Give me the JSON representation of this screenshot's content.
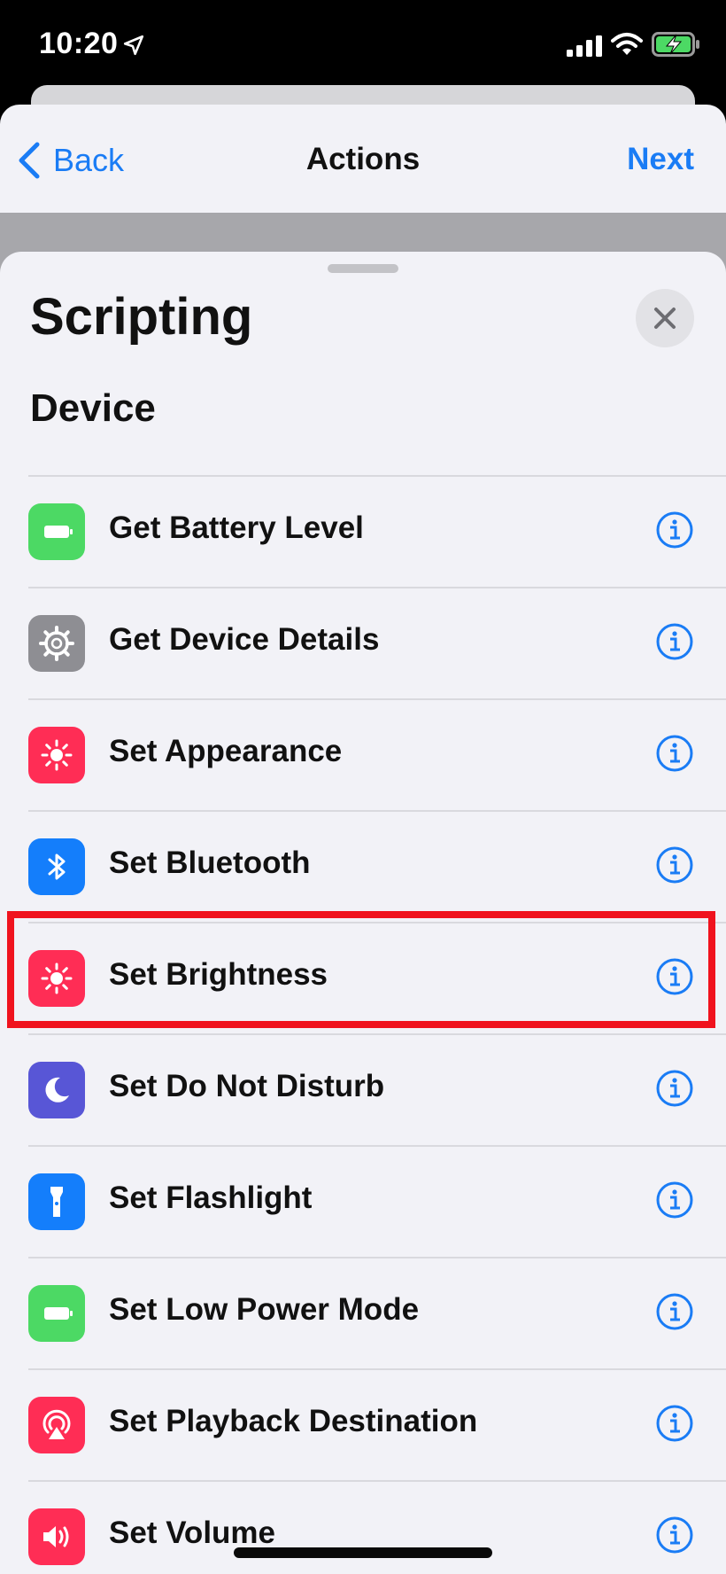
{
  "status_bar": {
    "time": "10:20"
  },
  "nav": {
    "back_label": "Back",
    "title": "Actions",
    "next_label": "Next"
  },
  "sheet": {
    "title": "Scripting",
    "section": "Device"
  },
  "actions": [
    {
      "label": "Get Battery Level",
      "icon": "battery-icon",
      "color": "#4cd964"
    },
    {
      "label": "Get Device Details",
      "icon": "gear-icon",
      "color": "#8e8e93"
    },
    {
      "label": "Set Appearance",
      "icon": "sun-icon",
      "color": "#ff2d55"
    },
    {
      "label": "Set Bluetooth",
      "icon": "bluetooth-icon",
      "color": "#147efb"
    },
    {
      "label": "Set Brightness",
      "icon": "sun-icon",
      "color": "#ff2d55"
    },
    {
      "label": "Set Do Not Disturb",
      "icon": "moon-icon",
      "color": "#5856d6"
    },
    {
      "label": "Set Flashlight",
      "icon": "flashlight-icon",
      "color": "#147efb"
    },
    {
      "label": "Set Low Power Mode",
      "icon": "battery-icon",
      "color": "#4cd964"
    },
    {
      "label": "Set Playback Destination",
      "icon": "airplay-icon",
      "color": "#ff2d55"
    },
    {
      "label": "Set Volume",
      "icon": "speaker-icon",
      "color": "#ff2d55"
    }
  ],
  "colors": {
    "accent": "#1a7cf5",
    "highlight": "#f0131e"
  }
}
